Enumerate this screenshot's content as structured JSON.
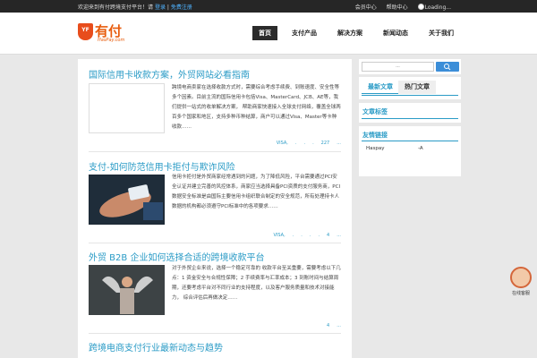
{
  "topbar": {
    "welcome": "欢迎来到有付跨境支付平台！请",
    "login": "登录",
    "divider": "|",
    "register": "免费注册",
    "right": [
      "会员中心",
      "帮助中心"
    ],
    "loading": "Loading..."
  },
  "logo": {
    "badge": "YF",
    "text": "有付",
    "sub": "HasPay.com"
  },
  "nav": [
    "首页",
    "支付产品",
    "解决方案",
    "新闻动态",
    "关于我们"
  ],
  "posts": [
    {
      "title": "国际信用卡收款方案，外贸网站必看指南",
      "excerpt": "跨境电商卖家在选择收款方式时，需要综合考虑手续费、到账速度、安全性等多个因素。目前主流的国际信用卡包括Visa、MasterCard、JCB、AE等，我们提供一站式的收单解决方案， 帮助商家快速接入全球支付网络，覆盖全球两百多个国家和地区，支持多种币种结算，商户可以通过Visa、Master等卡种收款……",
      "meta": [
        "VISA,",
        ".",
        ".",
        ".",
        "227",
        "..."
      ]
    },
    {
      "title": "支付-如何防范信用卡拒付与欺诈风险",
      "excerpt": "信用卡拒付是外贸商家经常遇到的问题，为了降低风险，平台需要通过PCI安全认证并建立完善的风控体系，商家应当选择具备PCI资质的支付服务商，PCI 数据安全标准是由国际主要信用卡组织联合制定的安全规范，所有处理持卡人数据的机构都必须遵守PCI标准中的各项要求……",
      "meta": [
        "VISA,",
        ".",
        ".",
        ".",
        ".",
        "4",
        "..."
      ]
    },
    {
      "title": "外贸 B2B 企业如何选择合适的跨境收款平台",
      "excerpt": "对于外贸企业来说，选择一个稳定可靠的 收款平台至关重要，需要考虑以下几点：1 资金安全与合规性保障；2 手续费率与汇率成本；3 到账时间与结算周期，还要考虑平台对不同行业的支持程度，以及客户服务质量和技术对接能力， 综合评估后再做决定……",
      "meta": [
        "4",
        "..."
      ]
    },
    {
      "title": "跨境电商支付行业最新动态与趋势",
      "excerpt": "",
      "meta": []
    }
  ],
  "sidebar": {
    "search_placeholder": "...",
    "tabs": [
      "最新文章",
      "热门文章"
    ],
    "widget2_title": "文章标签",
    "widget3_title": "友情链接",
    "links": [
      "Haspay",
      "-A"
    ]
  },
  "chat": {
    "label": "在线客服"
  },
  "colors": {
    "accent": "#2a9bc6",
    "brand": "#e85c0d",
    "topbar": "#262626"
  }
}
